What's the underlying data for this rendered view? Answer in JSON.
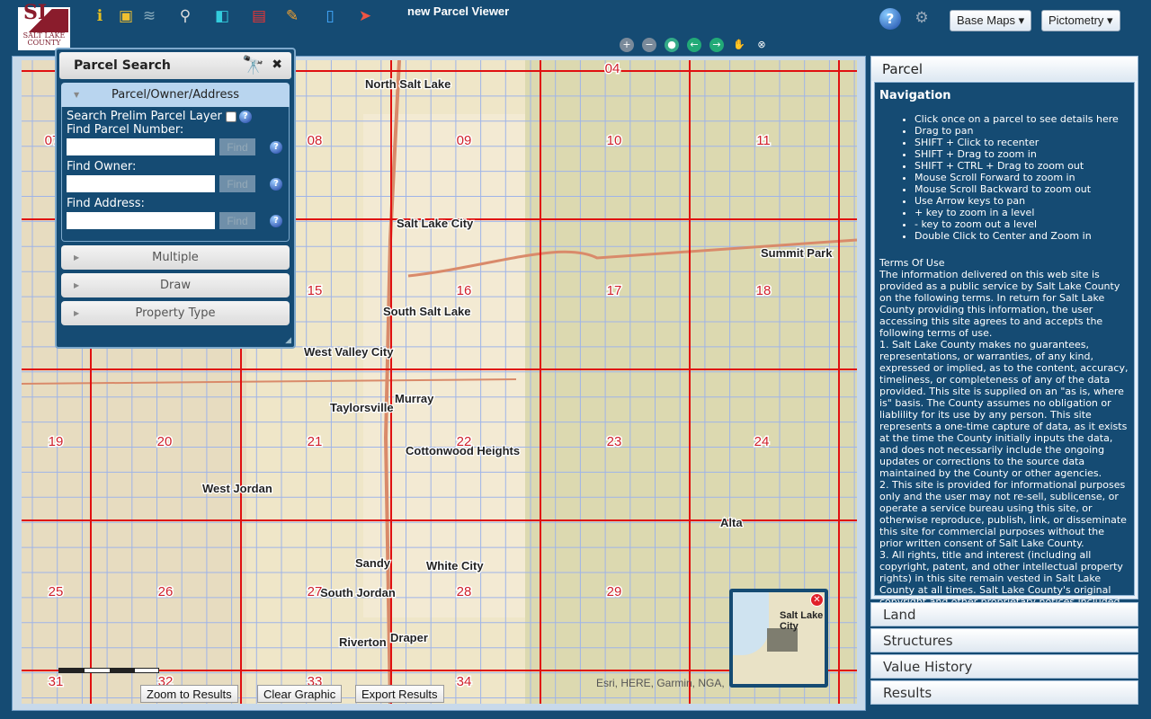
{
  "header": {
    "logo_text": "SALT LAKE COUNTY",
    "title": "new Parcel Viewer",
    "tools": [
      "identify-icon",
      "select-icon",
      "layers-icon",
      "search-binoculars-icon",
      "print-icon",
      "pdf-icon",
      "draw-pencil-icon",
      "measure-icon",
      "pictometry-icon"
    ],
    "help": "?",
    "base_maps": "Base Maps",
    "pictometry": "Pictometry"
  },
  "navtools": [
    "zoom-in-icon",
    "zoom-out-icon",
    "full-extent-icon",
    "back-icon",
    "forward-icon",
    "pan-icon",
    "deactivate-icon"
  ],
  "search": {
    "title": "Parcel Search",
    "tab_active": "Parcel/Owner/Address",
    "prelim": "Search Prelim Parcel Layer",
    "parcel_label": "Find Parcel Number:",
    "owner_label": "Find Owner:",
    "address_label": "Find Address:",
    "find": "Find",
    "parcel_value": "",
    "owner_value": "",
    "address_value": "",
    "tabs": [
      "Multiple",
      "Draw",
      "Property Type"
    ]
  },
  "map": {
    "sections": [
      [
        "04",
        680,
        80
      ],
      [
        "07",
        57,
        160
      ],
      [
        "08",
        349,
        160
      ],
      [
        "09",
        515,
        160
      ],
      [
        "10",
        682,
        160
      ],
      [
        "11",
        848,
        160
      ],
      [
        "15",
        349,
        327
      ],
      [
        "16",
        515,
        327
      ],
      [
        "17",
        682,
        327
      ],
      [
        "18",
        848,
        327
      ],
      [
        "19",
        61,
        495
      ],
      [
        "20",
        182,
        495
      ],
      [
        "21",
        349,
        495
      ],
      [
        "22",
        515,
        495
      ],
      [
        "23",
        682,
        495
      ],
      [
        "24",
        846,
        495
      ],
      [
        "25",
        61,
        662
      ],
      [
        "26",
        183,
        662
      ],
      [
        "27",
        349,
        662
      ],
      [
        "28",
        515,
        662
      ],
      [
        "29",
        682,
        662
      ],
      [
        "31",
        61,
        762
      ],
      [
        "32",
        183,
        762
      ],
      [
        "33",
        349,
        762
      ],
      [
        "34",
        515,
        762
      ]
    ],
    "places": [
      [
        "North Salt Lake",
        405,
        97
      ],
      [
        "Salt Lake City",
        440,
        252
      ],
      [
        "West Valley City",
        337,
        395
      ],
      [
        "Taylorsville",
        366,
        457
      ],
      [
        "Murray",
        438,
        447
      ],
      [
        "Cottonwood Heights",
        450,
        505
      ],
      [
        "West Jordan",
        224,
        547
      ],
      [
        "Sandy",
        394,
        630
      ],
      [
        "White City",
        473,
        633
      ],
      [
        "South Jordan",
        355,
        663
      ],
      [
        "Riverton",
        376,
        718
      ],
      [
        "Draper",
        433,
        713
      ],
      [
        "Summit Park",
        845,
        285
      ],
      [
        "Alta",
        800,
        585
      ],
      [
        "South Salt Lake",
        425,
        350
      ]
    ],
    "attribution": "Esri, HERE, Garmin, NGA,",
    "overview_label": "Salt Lake City"
  },
  "buttons": {
    "zoom_results": "Zoom to Results",
    "clear": "Clear Graphic",
    "export": "Export Results"
  },
  "panel": {
    "title": "Parcel",
    "nav_heading": "Navigation",
    "nav_items": [
      "Click once on a parcel to see details here",
      "Drag to pan",
      "SHIFT + Click to recenter",
      "SHIFT + Drag to zoom in",
      "SHIFT + CTRL + Drag to zoom out",
      "Mouse Scroll Forward to zoom in",
      "Mouse Scroll Backward to zoom out",
      "Use Arrow keys to pan",
      "+ key to zoom in a level",
      "- key to zoom out a level",
      "Double Click to Center and Zoom in"
    ],
    "terms_title": "Terms Of Use",
    "terms": "The information delivered on this web site is provided as a public service by Salt Lake County on the following terms. In return for Salt Lake County providing this information, the user accessing this site agrees to and accepts the following terms of use.\n1. Salt Lake County makes no guarantees, representations, or warranties, of any kind, expressed or implied, as to the content, accuracy, timeliness, or completeness of any of the data provided. This site is supplied on an \"as is, where is\" basis. The County assumes no obligation or liablility for its use by any person. This site represents a one-time capture of data, as it exists at the time the County initially inputs the data, and does not necessarily include the ongoing updates or corrections to the source data maintained by the County or other agencies.\n2. This site is provided for informational purposes only and the user may not re-sell, sublicense, or operate a service bureau using this site, or otherwise reproduce, publish, link, or disseminate this site for commercial purposes without the prior written consent of Salt Lake County.\n3. All rights, title and interest (including all copyright, patent, and other intellectual property rights) in this site remain vested in Salt Lake County at all times. Salt Lake County's original copyright and other proprietary notices included with this site must remain intact at all times.",
    "sections": [
      "Land",
      "Structures",
      "Value History",
      "Results"
    ]
  }
}
